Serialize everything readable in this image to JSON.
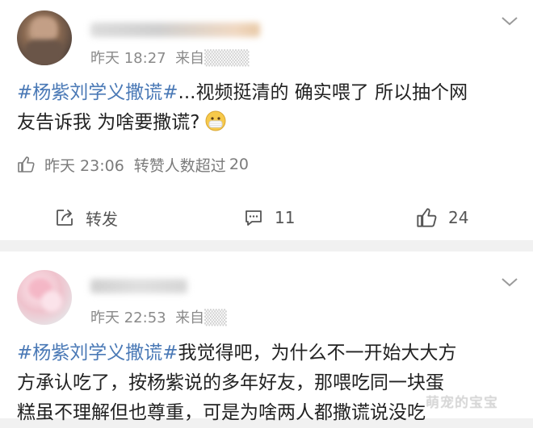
{
  "posts": [
    {
      "time": "昨天 18:27",
      "source": "来自",
      "hashtag": "#杨紫刘学义撒谎#",
      "text_line1": "...视频挺清的 确实喂了 所以抽个网",
      "text_line2": "友告诉我 为啥要撒谎?",
      "emoji": "mask-emoji-icon",
      "info": {
        "time": "昨天 23:06",
        "label": "转赞人数超过",
        "count": "20"
      },
      "actions": {
        "repost": "转发",
        "comments": "11",
        "likes": "24"
      }
    },
    {
      "time": "昨天 22:53",
      "source": "来自",
      "hashtag": "#杨紫刘学义撒谎#",
      "text_line1": "我觉得吧，为什么不一开始大大方",
      "text_line2": "方承认吃了，按杨紫说的多年好友，那喂吃同一块蛋",
      "text_line3": "糕虽不理解但也尊重，可是为啥两人都撒谎说没吃"
    }
  ],
  "watermark": "萌宠的宝宝",
  "colors": {
    "hashtag": "#4a79b6",
    "meta": "#8a8a8a",
    "separator": "#f1f1f1"
  }
}
